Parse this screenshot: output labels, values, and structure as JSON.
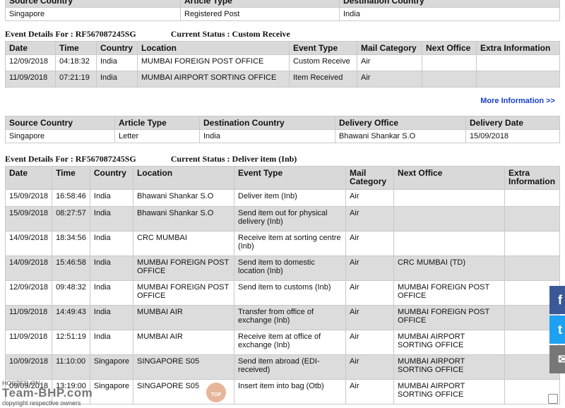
{
  "header_table": {
    "columns": [
      "Source Country",
      "Article Type",
      "Destination Country"
    ],
    "row": [
      "Singapore",
      "Registered Post",
      "India"
    ]
  },
  "event_section_1": {
    "label": "Event Details For : RF567087245SG",
    "status": "Current Status : Custom Receive",
    "columns": [
      "Date",
      "Time",
      "Country",
      "Location",
      "Event Type",
      "Mail Category",
      "Next Office",
      "Extra Information"
    ],
    "rows": [
      [
        "12/09/2018",
        "04:18:32",
        "India",
        "MUMBAI FOREIGN POST OFFICE",
        "Custom Receive",
        "Air",
        "",
        ""
      ],
      [
        "11/09/2018",
        "07:21:19",
        "India",
        "MUMBAI AIRPORT SORTING OFFICE",
        "Item Received",
        "Air",
        "",
        ""
      ]
    ]
  },
  "more_info_link": "More Information >>",
  "delivery_table": {
    "columns": [
      "Source Country",
      "Article Type",
      "Destination Country",
      "Delivery Office",
      "Delivery Date"
    ],
    "row": [
      "Singapore",
      "Letter",
      "India",
      "Bhawani Shankar S.O",
      "15/09/2018"
    ]
  },
  "event_section_2": {
    "label": "Event Details For : RF567087245SG",
    "status": "Current Status : Deliver item (Inb)",
    "columns": [
      "Date",
      "Time",
      "Country",
      "Location",
      "Event Type",
      "Mail Category",
      "Next Office",
      "Extra Information"
    ],
    "rows": [
      [
        "15/09/2018",
        "16:58:46",
        "India",
        "Bhawani Shankar S.O",
        "Deliver item (Inb)",
        "Air",
        "",
        ""
      ],
      [
        "15/09/2018",
        "08:27:57",
        "India",
        "Bhawani Shankar S.O",
        "Send item out for physical delivery (Inb)",
        "Air",
        "",
        ""
      ],
      [
        "14/09/2018",
        "18:34:56",
        "India",
        "CRC MUMBAI",
        "Receive item at sorting centre (Inb)",
        "Air",
        "",
        ""
      ],
      [
        "14/09/2018",
        "15:46:58",
        "India",
        "MUMBAI FOREIGN POST OFFICE",
        "Send item to domestic location (Inb)",
        "Air",
        "CRC MUMBAI (TD)",
        ""
      ],
      [
        "12/09/2018",
        "09:48:32",
        "India",
        "MUMBAI FOREIGN POST OFFICE",
        "Send item to customs (Inb)",
        "Air",
        "MUMBAI FOREIGN POST OFFICE",
        ""
      ],
      [
        "11/09/2018",
        "14:49:43",
        "India",
        "MUMBAI AIR",
        "Transfer from office of exchange (Inb)",
        "Air",
        "MUMBAI FOREIGN POST OFFICE",
        ""
      ],
      [
        "11/09/2018",
        "12:51:19",
        "India",
        "MUMBAI AIR",
        "Receive item at office of exchange (Inb)",
        "Air",
        "MUMBAI AIRPORT SORTING OFFICE",
        ""
      ],
      [
        "10/09/2018",
        "11:10:00",
        "Singapore",
        "SINGAPORE S05",
        "Send item abroad (EDI-received)",
        "Air",
        "MUMBAI AIRPORT SORTING OFFICE",
        ""
      ],
      [
        "09/09/2018",
        "13:19:00",
        "Singapore",
        "SINGAPORE S05",
        "Insert item into bag (Otb)",
        "Air",
        "MUMBAI AIRPORT SORTING OFFICE",
        ""
      ]
    ]
  },
  "share_buttons": [
    {
      "icon": "facebook-icon",
      "glyph": "f",
      "color": "#3b5998"
    },
    {
      "icon": "twitter-icon",
      "glyph": "t",
      "color": "#1da1f2"
    },
    {
      "icon": "email-icon",
      "glyph": "✉",
      "color": "#777777"
    }
  ],
  "watermark": {
    "hosted": "HOSTED ON :",
    "brand": "Team-BHP.com",
    "copyright": "copyright respective owners"
  },
  "top_button": "TOP"
}
